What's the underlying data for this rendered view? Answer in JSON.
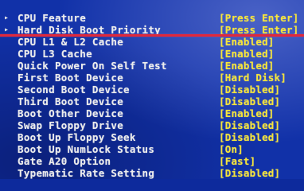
{
  "accent_colors": {
    "label": "#ececec",
    "value": "#f5e43a",
    "background": "#1131a8",
    "highlight_line": "#e0283c"
  },
  "items": [
    {
      "pointer": "▸",
      "label": "CPU Feature",
      "value": "[Press Enter]"
    },
    {
      "pointer": "▸",
      "label": "Hard Disk Boot Priority",
      "value": "[Press Enter]"
    },
    {
      "pointer": "",
      "label": "CPU L1 & L2 Cache",
      "value": "[Enabled]"
    },
    {
      "pointer": "",
      "label": "CPU L3 Cache",
      "value": "[Enabled]"
    },
    {
      "pointer": "",
      "label": "Quick Power On Self Test",
      "value": "[Enabled]"
    },
    {
      "pointer": "",
      "label": "First Boot Device",
      "value": "[Hard Disk]"
    },
    {
      "pointer": "",
      "label": "Second Boot Device",
      "value": "[Disabled]"
    },
    {
      "pointer": "",
      "label": "Third Boot Device",
      "value": "[Disabled]"
    },
    {
      "pointer": "",
      "label": "Boot Other Device",
      "value": "[Enabled]"
    },
    {
      "pointer": "",
      "label": "Swap Floppy Drive",
      "value": "[Disabled]"
    },
    {
      "pointer": "",
      "label": "Boot Up Floppy Seek",
      "value": "[Disabled]"
    },
    {
      "pointer": "",
      "label": "Boot Up NumLock Status",
      "value": "[On]"
    },
    {
      "pointer": "",
      "label": "Gate A20 Option",
      "value": "[Fast]"
    },
    {
      "pointer": "",
      "label": "Typematic Rate Setting",
      "value": "[Disabled]"
    }
  ]
}
